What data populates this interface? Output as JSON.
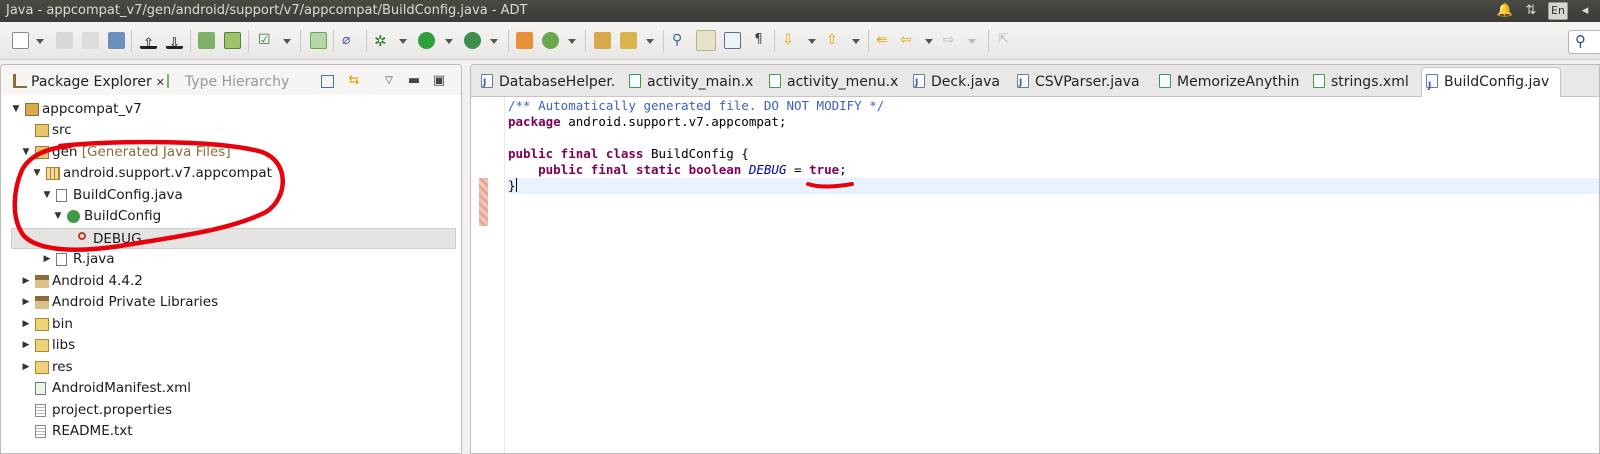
{
  "window": {
    "title": "Java - appcompat_v7/gen/android/support/v7/appcompat/BuildConfig.java - ADT"
  },
  "tray": {
    "keyboard_layout": "En"
  },
  "left_panel": {
    "tabs": [
      {
        "label": "Package Explorer",
        "close": "✕"
      },
      {
        "label": "Type Hierarchy"
      }
    ],
    "tree": [
      {
        "label": "appcompat_v7"
      },
      {
        "label": "src"
      },
      {
        "label": "gen",
        "decoration": "[Generated Java Files]"
      },
      {
        "label": "android.support.v7.appcompat"
      },
      {
        "label": "BuildConfig.java"
      },
      {
        "label": "BuildConfig"
      },
      {
        "label": "DEBUG"
      },
      {
        "label": "R.java"
      },
      {
        "label": "Android 4.4.2"
      },
      {
        "label": "Android Private Libraries"
      },
      {
        "label": "bin"
      },
      {
        "label": "libs"
      },
      {
        "label": "res"
      },
      {
        "label": "AndroidManifest.xml"
      },
      {
        "label": "project.properties"
      },
      {
        "label": "README.txt"
      }
    ]
  },
  "editor": {
    "tabs": [
      {
        "label": "DatabaseHelper.",
        "icon": "J"
      },
      {
        "label": "activity_main.x",
        "icon": "x"
      },
      {
        "label": "activity_menu.x",
        "icon": "x"
      },
      {
        "label": "Deck.java",
        "icon": "J"
      },
      {
        "label": "CSVParser.java",
        "icon": "J"
      },
      {
        "label": "MemorizeAnythin",
        "icon": "x"
      },
      {
        "label": "strings.xml",
        "icon": "x"
      },
      {
        "label": "BuildConfig.jav",
        "icon": "J"
      }
    ],
    "code": {
      "line1_comment": "/** Automatically generated file. DO NOT MODIFY */",
      "line2_kw": "package",
      "line2_rest": " android.support.v7.appcompat;",
      "line4_kw": "public final class",
      "line4_rest": " BuildConfig {",
      "line5_indent": "    ",
      "line5_kw": "public final static boolean",
      "line5_space": " ",
      "line5_field": "DEBUG",
      "line5_eq": " = ",
      "line5_val": "true",
      "line5_end": ";",
      "line6": "}"
    }
  },
  "colors": {
    "annotation": "#e8000b"
  }
}
